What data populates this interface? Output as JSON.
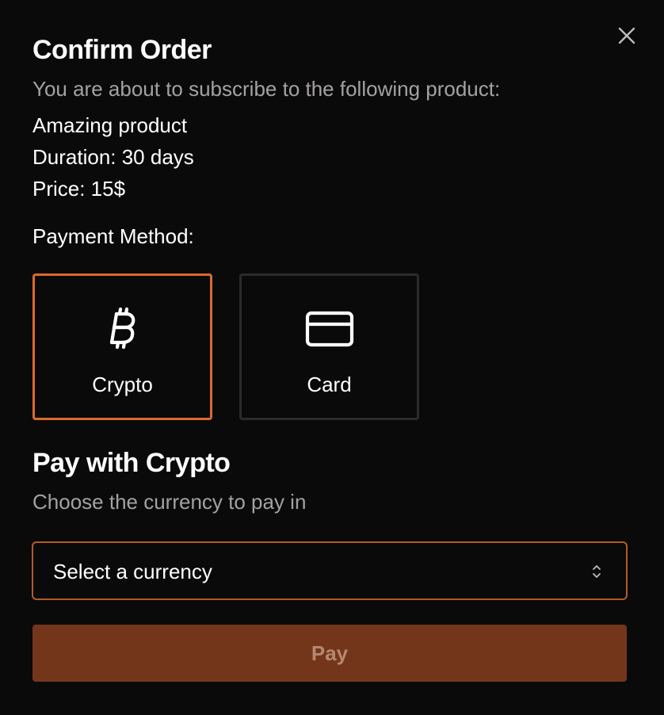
{
  "dialog": {
    "title": "Confirm Order",
    "subtitle": "You are about to subscribe to the following product:",
    "product": {
      "name": "Amazing product",
      "duration": "Duration: 30 days",
      "price": "Price: 15$"
    },
    "payment_method_label": "Payment Method:",
    "methods": [
      {
        "label": "Crypto",
        "icon": "bitcoin-icon",
        "selected": true
      },
      {
        "label": "Card",
        "icon": "credit-card-icon",
        "selected": false
      }
    ],
    "section": {
      "title": "Pay with Crypto",
      "subtitle": "Choose the currency to pay in"
    },
    "currency_select": {
      "placeholder": "Select a currency",
      "icon": "chevron-up-down-icon"
    },
    "pay_label": "Pay",
    "close_icon": "close-icon"
  },
  "colors": {
    "background": "#0b0a0a",
    "accent": "#dc6a2d",
    "pay_button": "#74361b",
    "muted_text": "#a4a2a1"
  }
}
